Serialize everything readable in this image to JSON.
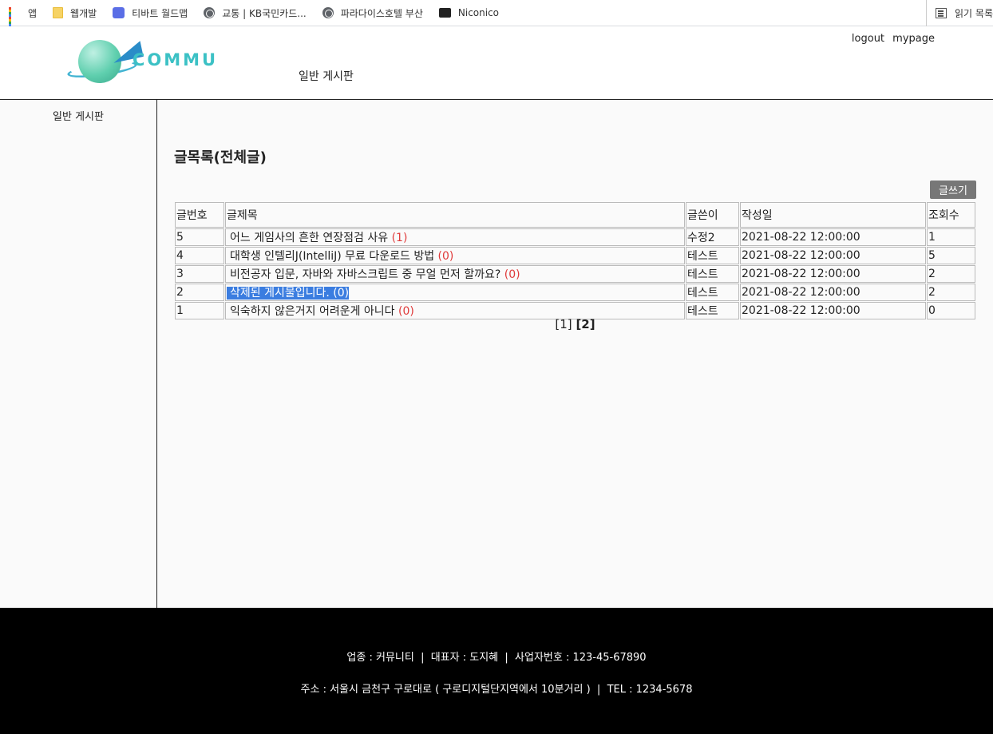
{
  "bookmarks": [
    {
      "label": "앱",
      "icon": "apps-grid-icon"
    },
    {
      "label": "웹개발",
      "icon": "folder-icon"
    },
    {
      "label": "티바트 월드맵",
      "icon": "game-icon"
    },
    {
      "label": "교통 | KB국민카드...",
      "icon": "globe-icon"
    },
    {
      "label": "파라다이스호텔 부산",
      "icon": "globe-icon"
    },
    {
      "label": "Niconico",
      "icon": "tv-icon"
    }
  ],
  "reading_list": {
    "label": "읽기 목록",
    "icon": "reading-list-icon"
  },
  "header": {
    "logo_text": "COMMU",
    "logout": "logout",
    "mypage": "mypage",
    "menu": "일반 게시판"
  },
  "sidebar": {
    "items": [
      {
        "label": "일반 게시판"
      }
    ]
  },
  "board": {
    "title": "글목록(전체글)",
    "write_button": "글쓰기",
    "columns": [
      "글번호",
      "글제목",
      "글쓴이",
      "작성일",
      "조회수"
    ],
    "rows": [
      {
        "no": "5",
        "title": "어느 게임사의 흔한 연장점검 사유",
        "comments": "(1)",
        "author": "수정2",
        "date": "2021-08-22 12:00:00",
        "views": "1",
        "selected": false
      },
      {
        "no": "4",
        "title": "대학생 인텔리J(IntelliJ) 무료 다운로드 방법",
        "comments": "(0)",
        "author": "테스트",
        "date": "2021-08-22 12:00:00",
        "views": "5",
        "selected": false
      },
      {
        "no": "3",
        "title": "비전공자 입문, 자바와 자바스크립트 중 무얼 먼저 할까요?",
        "comments": "(0)",
        "author": "테스트",
        "date": "2021-08-22 12:00:00",
        "views": "2",
        "selected": false
      },
      {
        "no": "2",
        "title": "삭제된 게시물입니다.",
        "comments": "(0)",
        "author": "테스트",
        "date": "2021-08-22 12:00:00",
        "views": "2",
        "selected": true
      },
      {
        "no": "1",
        "title": "익숙하지 않은거지 어려운게 아니다",
        "comments": "(0)",
        "author": "테스트",
        "date": "2021-08-22 12:00:00",
        "views": "0",
        "selected": false
      }
    ],
    "pagination": {
      "pages": [
        "[1]",
        "[2]"
      ],
      "current": "[2]"
    }
  },
  "footer": {
    "line1": "업종 : 커뮤니티  |  대표자 : 도지혜  |  사업자번호 : 123-45-67890",
    "line2": "주소 : 서울시 금천구 구로대로 ( 구로디지털단지역에서 10분거리 )  |  TEL : 1234-5678"
  },
  "colors": {
    "comment_count": "#e03b3b",
    "selection": "#3b7de0",
    "logo": "#3cc1c5",
    "write_button": "#777777",
    "footer_bg": "#000000"
  }
}
